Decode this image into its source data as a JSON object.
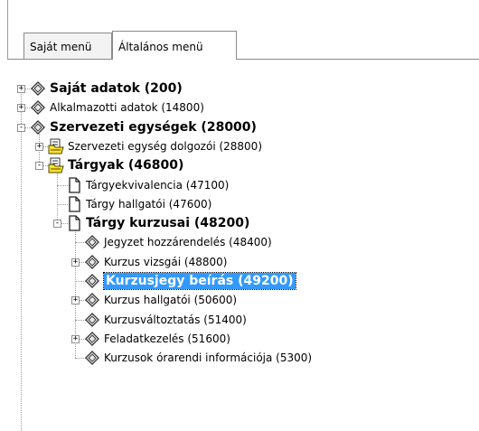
{
  "tabs": [
    {
      "label": "Saját menü",
      "active": false
    },
    {
      "label": "Általános menü",
      "active": true
    }
  ],
  "tree": [
    {
      "label": "Saját adatok (200)",
      "bold": true,
      "icon": "diamond-icon",
      "expander": "+"
    },
    {
      "label": "Alkalmazotti adatok (14800)",
      "bold": false,
      "icon": "diamond-icon",
      "expander": "+"
    },
    {
      "label": "Szervezeti egységek (28000)",
      "bold": true,
      "icon": "diamond-icon",
      "expander": "-"
    },
    {
      "label": "Szervezeti egység dolgozói (28800)",
      "bold": false,
      "icon": "folder-doc-icon",
      "expander": "+"
    },
    {
      "label": "Tárgyak (46800)",
      "bold": true,
      "icon": "folder-doc-icon",
      "expander": "-"
    },
    {
      "label": "Tárgyekvivalencia (47100)",
      "bold": false,
      "icon": "page-icon",
      "expander": ""
    },
    {
      "label": "Tárgy hallgatói (47600)",
      "bold": false,
      "icon": "page-icon",
      "expander": ""
    },
    {
      "label": "Tárgy kurzusai (48200)",
      "bold": true,
      "icon": "page-icon",
      "expander": "-"
    },
    {
      "label": "Jegyzet hozzárendelés (48400)",
      "bold": false,
      "icon": "diamond-icon",
      "expander": ""
    },
    {
      "label": "Kurzus vizsgái (48800)",
      "bold": false,
      "icon": "diamond-icon",
      "expander": "+"
    },
    {
      "label": "Kurzusjegy beírás (49200)",
      "bold": true,
      "icon": "diamond-icon",
      "expander": "",
      "selected": true
    },
    {
      "label": "Kurzus hallgatói (50600)",
      "bold": false,
      "icon": "diamond-icon",
      "expander": "+"
    },
    {
      "label": "Kurzusváltoztatás (51400)",
      "bold": false,
      "icon": "diamond-icon",
      "expander": ""
    },
    {
      "label": "Feladatkezelés (51600)",
      "bold": false,
      "icon": "diamond-icon",
      "expander": "+"
    },
    {
      "label": "Kurzusok órarendi információja (5300)",
      "bold": false,
      "icon": "diamond-icon",
      "expander": ""
    }
  ],
  "colors": {
    "selection": "#3399ff",
    "folder": "#ffe030"
  }
}
